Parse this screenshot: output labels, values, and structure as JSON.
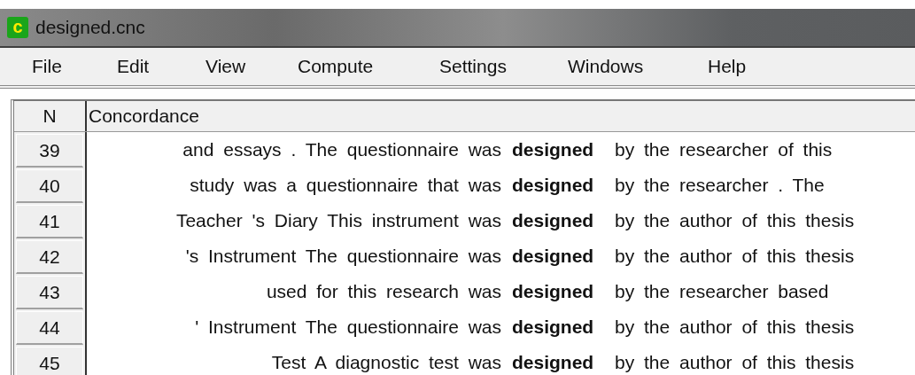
{
  "window": {
    "title": "designed.cnc",
    "icon_letter": "c"
  },
  "menu": [
    "File",
    "Edit",
    "View",
    "Compute",
    "Settings",
    "Windows",
    "Help"
  ],
  "table": {
    "columns": [
      "N",
      "Concordance"
    ],
    "rows": [
      {
        "n": "39",
        "left": "and essays . The questionnaire was",
        "keyword": "designed",
        "right": "by the researcher of this"
      },
      {
        "n": "40",
        "left": "study was a questionnaire that was",
        "keyword": "designed",
        "right": "by the researcher . The"
      },
      {
        "n": "41",
        "left": "Teacher 's Diary This instrument was",
        "keyword": "designed",
        "right": "by the author of this thesis"
      },
      {
        "n": "42",
        "left": "'s Instrument The questionnaire was",
        "keyword": "designed",
        "right": "by the author of this thesis"
      },
      {
        "n": "43",
        "left": "used for this research was",
        "keyword": "designed",
        "right": "by the researcher based"
      },
      {
        "n": "44",
        "left": "' Instrument The questionnaire was",
        "keyword": "designed",
        "right": "by the author of this thesis"
      },
      {
        "n": "45",
        "left": "Test A diagnostic test was",
        "keyword": "designed",
        "right": "by the author of this thesis"
      }
    ]
  }
}
